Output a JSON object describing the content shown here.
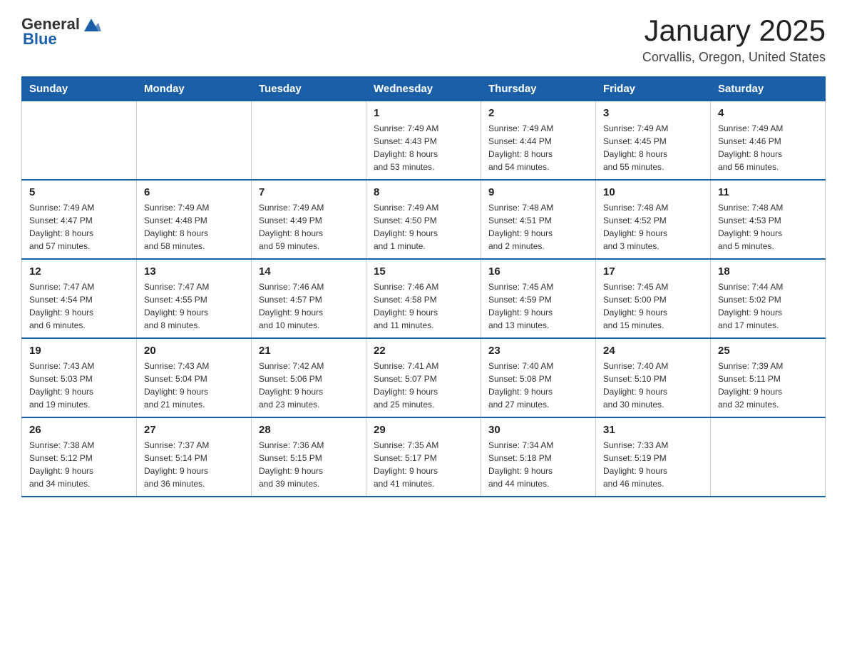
{
  "header": {
    "logo_general": "General",
    "logo_blue": "Blue",
    "month_title": "January 2025",
    "location": "Corvallis, Oregon, United States"
  },
  "days_of_week": [
    "Sunday",
    "Monday",
    "Tuesday",
    "Wednesday",
    "Thursday",
    "Friday",
    "Saturday"
  ],
  "weeks": [
    [
      {
        "day": "",
        "info": ""
      },
      {
        "day": "",
        "info": ""
      },
      {
        "day": "",
        "info": ""
      },
      {
        "day": "1",
        "info": "Sunrise: 7:49 AM\nSunset: 4:43 PM\nDaylight: 8 hours\nand 53 minutes."
      },
      {
        "day": "2",
        "info": "Sunrise: 7:49 AM\nSunset: 4:44 PM\nDaylight: 8 hours\nand 54 minutes."
      },
      {
        "day": "3",
        "info": "Sunrise: 7:49 AM\nSunset: 4:45 PM\nDaylight: 8 hours\nand 55 minutes."
      },
      {
        "day": "4",
        "info": "Sunrise: 7:49 AM\nSunset: 4:46 PM\nDaylight: 8 hours\nand 56 minutes."
      }
    ],
    [
      {
        "day": "5",
        "info": "Sunrise: 7:49 AM\nSunset: 4:47 PM\nDaylight: 8 hours\nand 57 minutes."
      },
      {
        "day": "6",
        "info": "Sunrise: 7:49 AM\nSunset: 4:48 PM\nDaylight: 8 hours\nand 58 minutes."
      },
      {
        "day": "7",
        "info": "Sunrise: 7:49 AM\nSunset: 4:49 PM\nDaylight: 8 hours\nand 59 minutes."
      },
      {
        "day": "8",
        "info": "Sunrise: 7:49 AM\nSunset: 4:50 PM\nDaylight: 9 hours\nand 1 minute."
      },
      {
        "day": "9",
        "info": "Sunrise: 7:48 AM\nSunset: 4:51 PM\nDaylight: 9 hours\nand 2 minutes."
      },
      {
        "day": "10",
        "info": "Sunrise: 7:48 AM\nSunset: 4:52 PM\nDaylight: 9 hours\nand 3 minutes."
      },
      {
        "day": "11",
        "info": "Sunrise: 7:48 AM\nSunset: 4:53 PM\nDaylight: 9 hours\nand 5 minutes."
      }
    ],
    [
      {
        "day": "12",
        "info": "Sunrise: 7:47 AM\nSunset: 4:54 PM\nDaylight: 9 hours\nand 6 minutes."
      },
      {
        "day": "13",
        "info": "Sunrise: 7:47 AM\nSunset: 4:55 PM\nDaylight: 9 hours\nand 8 minutes."
      },
      {
        "day": "14",
        "info": "Sunrise: 7:46 AM\nSunset: 4:57 PM\nDaylight: 9 hours\nand 10 minutes."
      },
      {
        "day": "15",
        "info": "Sunrise: 7:46 AM\nSunset: 4:58 PM\nDaylight: 9 hours\nand 11 minutes."
      },
      {
        "day": "16",
        "info": "Sunrise: 7:45 AM\nSunset: 4:59 PM\nDaylight: 9 hours\nand 13 minutes."
      },
      {
        "day": "17",
        "info": "Sunrise: 7:45 AM\nSunset: 5:00 PM\nDaylight: 9 hours\nand 15 minutes."
      },
      {
        "day": "18",
        "info": "Sunrise: 7:44 AM\nSunset: 5:02 PM\nDaylight: 9 hours\nand 17 minutes."
      }
    ],
    [
      {
        "day": "19",
        "info": "Sunrise: 7:43 AM\nSunset: 5:03 PM\nDaylight: 9 hours\nand 19 minutes."
      },
      {
        "day": "20",
        "info": "Sunrise: 7:43 AM\nSunset: 5:04 PM\nDaylight: 9 hours\nand 21 minutes."
      },
      {
        "day": "21",
        "info": "Sunrise: 7:42 AM\nSunset: 5:06 PM\nDaylight: 9 hours\nand 23 minutes."
      },
      {
        "day": "22",
        "info": "Sunrise: 7:41 AM\nSunset: 5:07 PM\nDaylight: 9 hours\nand 25 minutes."
      },
      {
        "day": "23",
        "info": "Sunrise: 7:40 AM\nSunset: 5:08 PM\nDaylight: 9 hours\nand 27 minutes."
      },
      {
        "day": "24",
        "info": "Sunrise: 7:40 AM\nSunset: 5:10 PM\nDaylight: 9 hours\nand 30 minutes."
      },
      {
        "day": "25",
        "info": "Sunrise: 7:39 AM\nSunset: 5:11 PM\nDaylight: 9 hours\nand 32 minutes."
      }
    ],
    [
      {
        "day": "26",
        "info": "Sunrise: 7:38 AM\nSunset: 5:12 PM\nDaylight: 9 hours\nand 34 minutes."
      },
      {
        "day": "27",
        "info": "Sunrise: 7:37 AM\nSunset: 5:14 PM\nDaylight: 9 hours\nand 36 minutes."
      },
      {
        "day": "28",
        "info": "Sunrise: 7:36 AM\nSunset: 5:15 PM\nDaylight: 9 hours\nand 39 minutes."
      },
      {
        "day": "29",
        "info": "Sunrise: 7:35 AM\nSunset: 5:17 PM\nDaylight: 9 hours\nand 41 minutes."
      },
      {
        "day": "30",
        "info": "Sunrise: 7:34 AM\nSunset: 5:18 PM\nDaylight: 9 hours\nand 44 minutes."
      },
      {
        "day": "31",
        "info": "Sunrise: 7:33 AM\nSunset: 5:19 PM\nDaylight: 9 hours\nand 46 minutes."
      },
      {
        "day": "",
        "info": ""
      }
    ]
  ]
}
